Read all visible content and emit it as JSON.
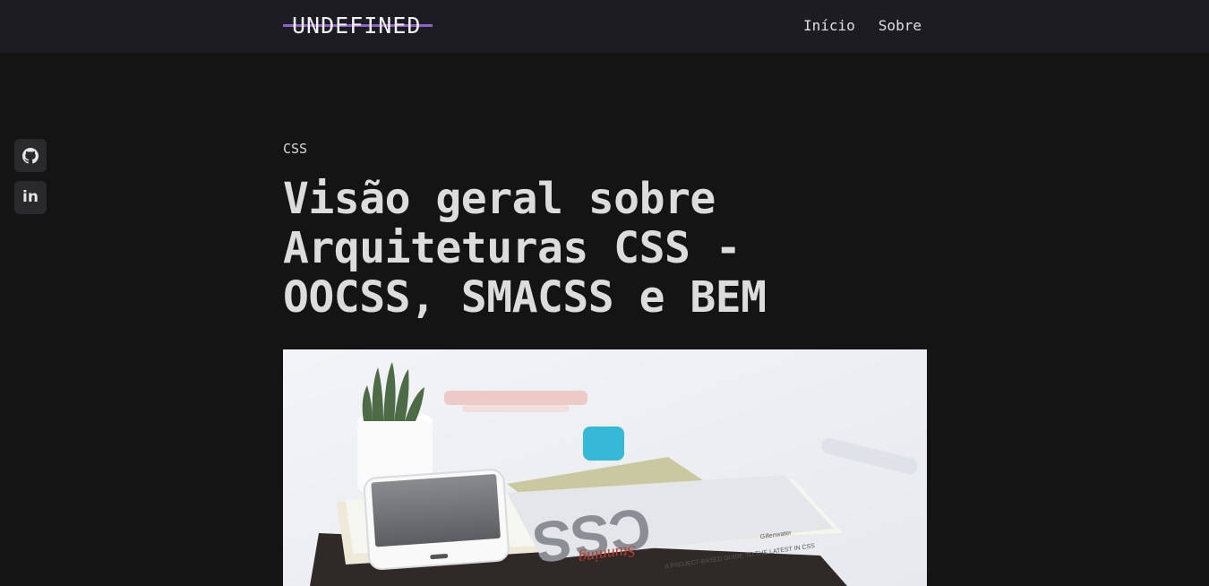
{
  "header": {
    "logo": "UNDEFINED",
    "nav": [
      {
        "label": "Início"
      },
      {
        "label": "Sobre"
      }
    ]
  },
  "social": [
    {
      "icon": "github-icon"
    },
    {
      "icon": "linkedin-icon",
      "label": "in"
    }
  ],
  "article": {
    "category": "CSS",
    "title": "Visão geral sobre Arquiteturas CSS - OOCSS, SMACSS e BEM",
    "hero_image": {
      "book_cover_text": "CSS",
      "book_subtitle": "Stunning",
      "book_tagline": "A PROJECT-BASED GUIDE TO THE LATEST IN CSS",
      "book_author": "Gillenwater"
    }
  },
  "colors": {
    "background": "#141414",
    "header_bg": "#1d1c22",
    "accent": "#8a62c8",
    "text": "#dcdcdc"
  }
}
